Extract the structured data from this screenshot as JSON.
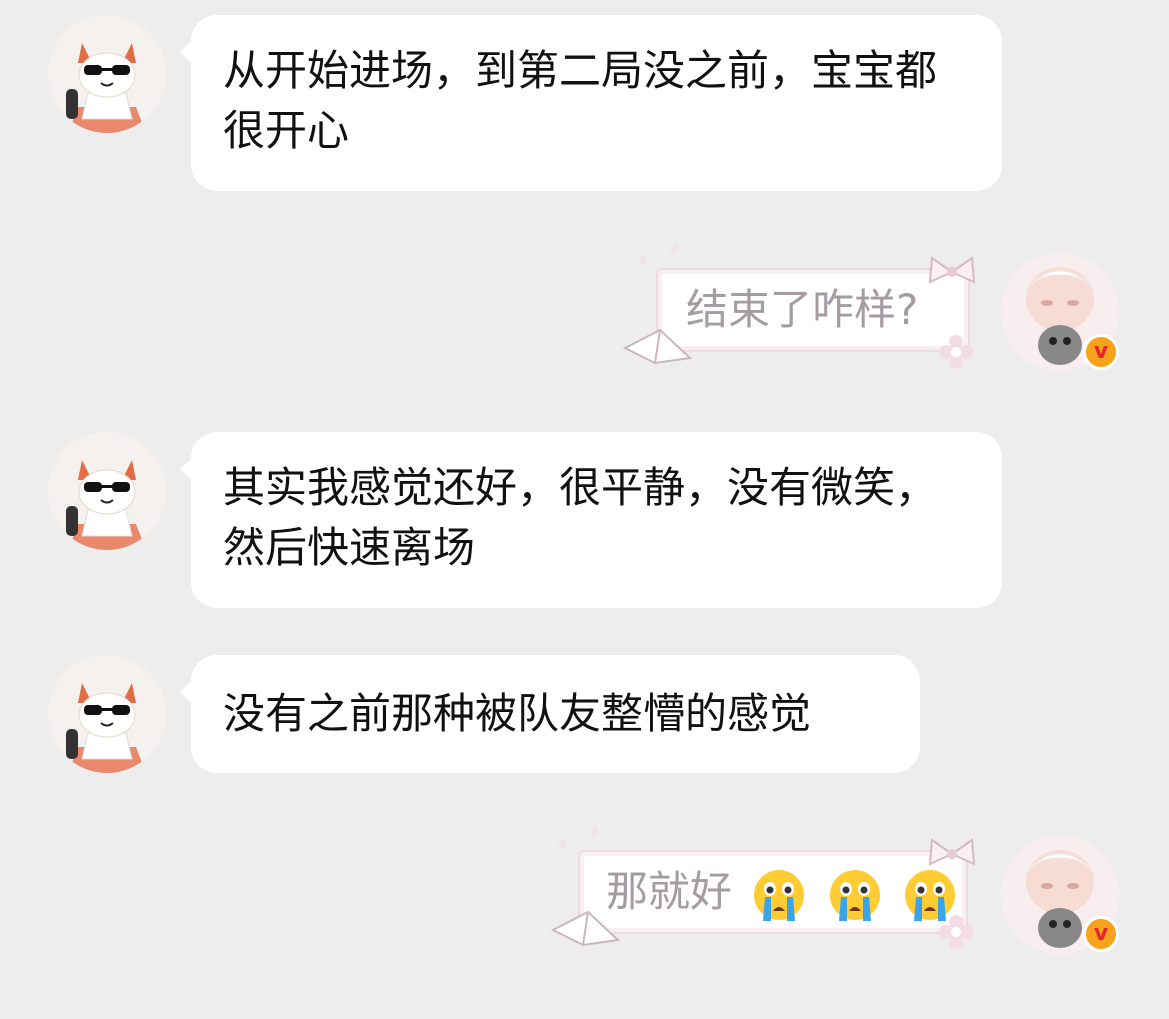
{
  "messages": [
    {
      "side": "left",
      "text": "从开始进场，到第二局没之前，宝宝都很开心"
    },
    {
      "side": "right",
      "text": "结束了咋样?"
    },
    {
      "side": "left",
      "text": "其实我感觉还好，很平静，没有微笑，然后快速离场"
    },
    {
      "side": "left",
      "text": "没有之前那种被队友整懵的感觉"
    },
    {
      "side": "right",
      "text": "那就好",
      "emojis": [
        "loudly-crying-face-icon",
        "loudly-crying-face-icon",
        "loudly-crying-face-icon"
      ]
    }
  ],
  "badge": {
    "label": "v",
    "color": "#f6a21a"
  }
}
